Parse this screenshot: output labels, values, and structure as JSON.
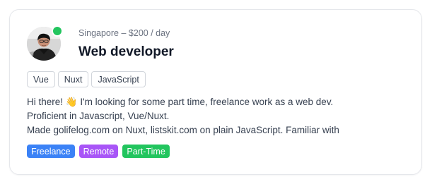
{
  "profile": {
    "location": "Singapore",
    "separator": "–",
    "rate": "$200 / day",
    "title": "Web developer",
    "online": true
  },
  "skills": [
    "Vue",
    "Nuxt",
    "JavaScript"
  ],
  "bio": {
    "lines": [
      "Hi there! 👋 I'm looking for some part time, freelance work as a web dev.",
      "Proficient in Javascript, Vue/Nuxt.",
      "Made golifelog.com on Nuxt, listskit.com on plain JavaScript. Familiar with"
    ]
  },
  "tags": [
    {
      "label": "Freelance",
      "color": "#3b82f6"
    },
    {
      "label": "Remote",
      "color": "#a855f7"
    },
    {
      "label": "Part-Time",
      "color": "#22c55e"
    }
  ],
  "colors": {
    "online": "#22c55e",
    "card_border": "#e5e7eb",
    "muted_text": "#6b7280",
    "body_text": "#374151"
  },
  "icons": {
    "avatar": "avatar-photo",
    "status": "online-status-icon"
  }
}
